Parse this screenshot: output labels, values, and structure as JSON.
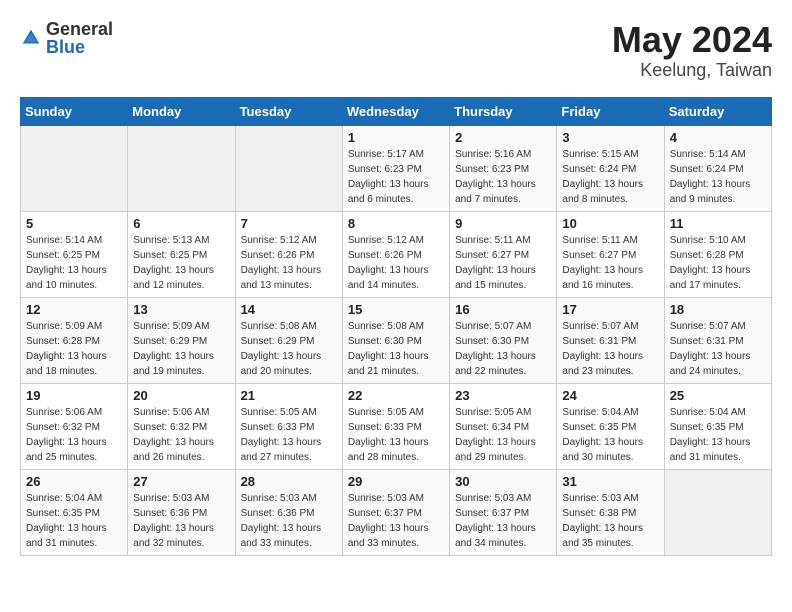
{
  "logo": {
    "text_general": "General",
    "text_blue": "Blue"
  },
  "title": {
    "month_year": "May 2024",
    "location": "Keelung, Taiwan"
  },
  "weekdays": [
    "Sunday",
    "Monday",
    "Tuesday",
    "Wednesday",
    "Thursday",
    "Friday",
    "Saturday"
  ],
  "weeks": [
    [
      {
        "day": "",
        "info": ""
      },
      {
        "day": "",
        "info": ""
      },
      {
        "day": "",
        "info": ""
      },
      {
        "day": "1",
        "info": "Sunrise: 5:17 AM\nSunset: 6:23 PM\nDaylight: 13 hours\nand 6 minutes."
      },
      {
        "day": "2",
        "info": "Sunrise: 5:16 AM\nSunset: 6:23 PM\nDaylight: 13 hours\nand 7 minutes."
      },
      {
        "day": "3",
        "info": "Sunrise: 5:15 AM\nSunset: 6:24 PM\nDaylight: 13 hours\nand 8 minutes."
      },
      {
        "day": "4",
        "info": "Sunrise: 5:14 AM\nSunset: 6:24 PM\nDaylight: 13 hours\nand 9 minutes."
      }
    ],
    [
      {
        "day": "5",
        "info": "Sunrise: 5:14 AM\nSunset: 6:25 PM\nDaylight: 13 hours\nand 10 minutes."
      },
      {
        "day": "6",
        "info": "Sunrise: 5:13 AM\nSunset: 6:25 PM\nDaylight: 13 hours\nand 12 minutes."
      },
      {
        "day": "7",
        "info": "Sunrise: 5:12 AM\nSunset: 6:26 PM\nDaylight: 13 hours\nand 13 minutes."
      },
      {
        "day": "8",
        "info": "Sunrise: 5:12 AM\nSunset: 6:26 PM\nDaylight: 13 hours\nand 14 minutes."
      },
      {
        "day": "9",
        "info": "Sunrise: 5:11 AM\nSunset: 6:27 PM\nDaylight: 13 hours\nand 15 minutes."
      },
      {
        "day": "10",
        "info": "Sunrise: 5:11 AM\nSunset: 6:27 PM\nDaylight: 13 hours\nand 16 minutes."
      },
      {
        "day": "11",
        "info": "Sunrise: 5:10 AM\nSunset: 6:28 PM\nDaylight: 13 hours\nand 17 minutes."
      }
    ],
    [
      {
        "day": "12",
        "info": "Sunrise: 5:09 AM\nSunset: 6:28 PM\nDaylight: 13 hours\nand 18 minutes."
      },
      {
        "day": "13",
        "info": "Sunrise: 5:09 AM\nSunset: 6:29 PM\nDaylight: 13 hours\nand 19 minutes."
      },
      {
        "day": "14",
        "info": "Sunrise: 5:08 AM\nSunset: 6:29 PM\nDaylight: 13 hours\nand 20 minutes."
      },
      {
        "day": "15",
        "info": "Sunrise: 5:08 AM\nSunset: 6:30 PM\nDaylight: 13 hours\nand 21 minutes."
      },
      {
        "day": "16",
        "info": "Sunrise: 5:07 AM\nSunset: 6:30 PM\nDaylight: 13 hours\nand 22 minutes."
      },
      {
        "day": "17",
        "info": "Sunrise: 5:07 AM\nSunset: 6:31 PM\nDaylight: 13 hours\nand 23 minutes."
      },
      {
        "day": "18",
        "info": "Sunrise: 5:07 AM\nSunset: 6:31 PM\nDaylight: 13 hours\nand 24 minutes."
      }
    ],
    [
      {
        "day": "19",
        "info": "Sunrise: 5:06 AM\nSunset: 6:32 PM\nDaylight: 13 hours\nand 25 minutes."
      },
      {
        "day": "20",
        "info": "Sunrise: 5:06 AM\nSunset: 6:32 PM\nDaylight: 13 hours\nand 26 minutes."
      },
      {
        "day": "21",
        "info": "Sunrise: 5:05 AM\nSunset: 6:33 PM\nDaylight: 13 hours\nand 27 minutes."
      },
      {
        "day": "22",
        "info": "Sunrise: 5:05 AM\nSunset: 6:33 PM\nDaylight: 13 hours\nand 28 minutes."
      },
      {
        "day": "23",
        "info": "Sunrise: 5:05 AM\nSunset: 6:34 PM\nDaylight: 13 hours\nand 29 minutes."
      },
      {
        "day": "24",
        "info": "Sunrise: 5:04 AM\nSunset: 6:35 PM\nDaylight: 13 hours\nand 30 minutes."
      },
      {
        "day": "25",
        "info": "Sunrise: 5:04 AM\nSunset: 6:35 PM\nDaylight: 13 hours\nand 31 minutes."
      }
    ],
    [
      {
        "day": "26",
        "info": "Sunrise: 5:04 AM\nSunset: 6:35 PM\nDaylight: 13 hours\nand 31 minutes."
      },
      {
        "day": "27",
        "info": "Sunrise: 5:03 AM\nSunset: 6:36 PM\nDaylight: 13 hours\nand 32 minutes."
      },
      {
        "day": "28",
        "info": "Sunrise: 5:03 AM\nSunset: 6:36 PM\nDaylight: 13 hours\nand 33 minutes."
      },
      {
        "day": "29",
        "info": "Sunrise: 5:03 AM\nSunset: 6:37 PM\nDaylight: 13 hours\nand 33 minutes."
      },
      {
        "day": "30",
        "info": "Sunrise: 5:03 AM\nSunset: 6:37 PM\nDaylight: 13 hours\nand 34 minutes."
      },
      {
        "day": "31",
        "info": "Sunrise: 5:03 AM\nSunset: 6:38 PM\nDaylight: 13 hours\nand 35 minutes."
      },
      {
        "day": "",
        "info": ""
      }
    ]
  ]
}
